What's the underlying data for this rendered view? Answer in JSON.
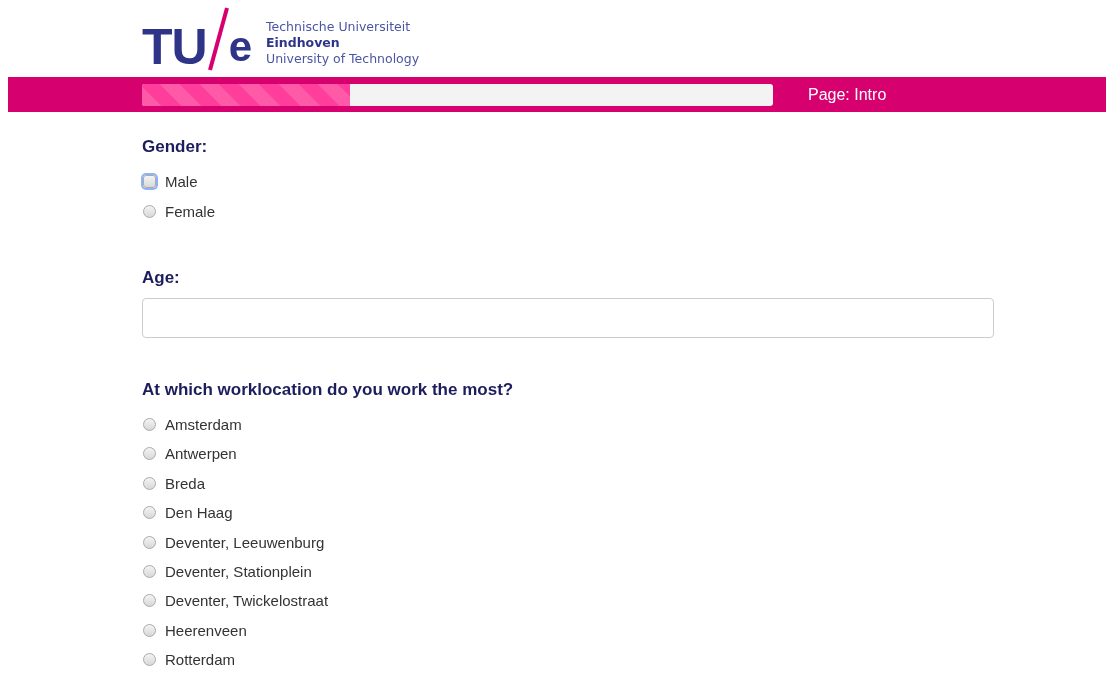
{
  "logo": {
    "mark_left": "TU",
    "mark_right": "e",
    "lines": [
      "Technische Universiteit",
      "Eindhoven",
      "University of Technology"
    ]
  },
  "progress": {
    "level": 0.33,
    "page_label": "Page: Intro"
  },
  "questions": [
    {
      "kind": "radio",
      "title": "Gender:",
      "options": [
        {
          "label": "Male",
          "selected": false,
          "focused": true
        },
        {
          "label": "Female",
          "selected": false,
          "focused": false
        }
      ]
    },
    {
      "kind": "text",
      "title": "Age:"
    },
    {
      "kind": "radio",
      "title": "At which worklocation do you work the most?",
      "options": [
        {
          "label": "Amsterdam",
          "selected": false,
          "focused": false
        },
        {
          "label": "Antwerpen",
          "selected": false,
          "focused": false
        },
        {
          "label": "Breda",
          "selected": false,
          "focused": false
        },
        {
          "label": "Den Haag",
          "selected": false,
          "focused": false
        },
        {
          "label": "Deventer, Leeuwenburg",
          "selected": false,
          "focused": false
        },
        {
          "label": "Deventer, Stationplein",
          "selected": false,
          "focused": false
        },
        {
          "label": "Deventer, Twickelostraat",
          "selected": false,
          "focused": false
        },
        {
          "label": "Heerenveen",
          "selected": false,
          "focused": false
        },
        {
          "label": "Rotterdam",
          "selected": false,
          "focused": false
        }
      ]
    }
  ]
}
